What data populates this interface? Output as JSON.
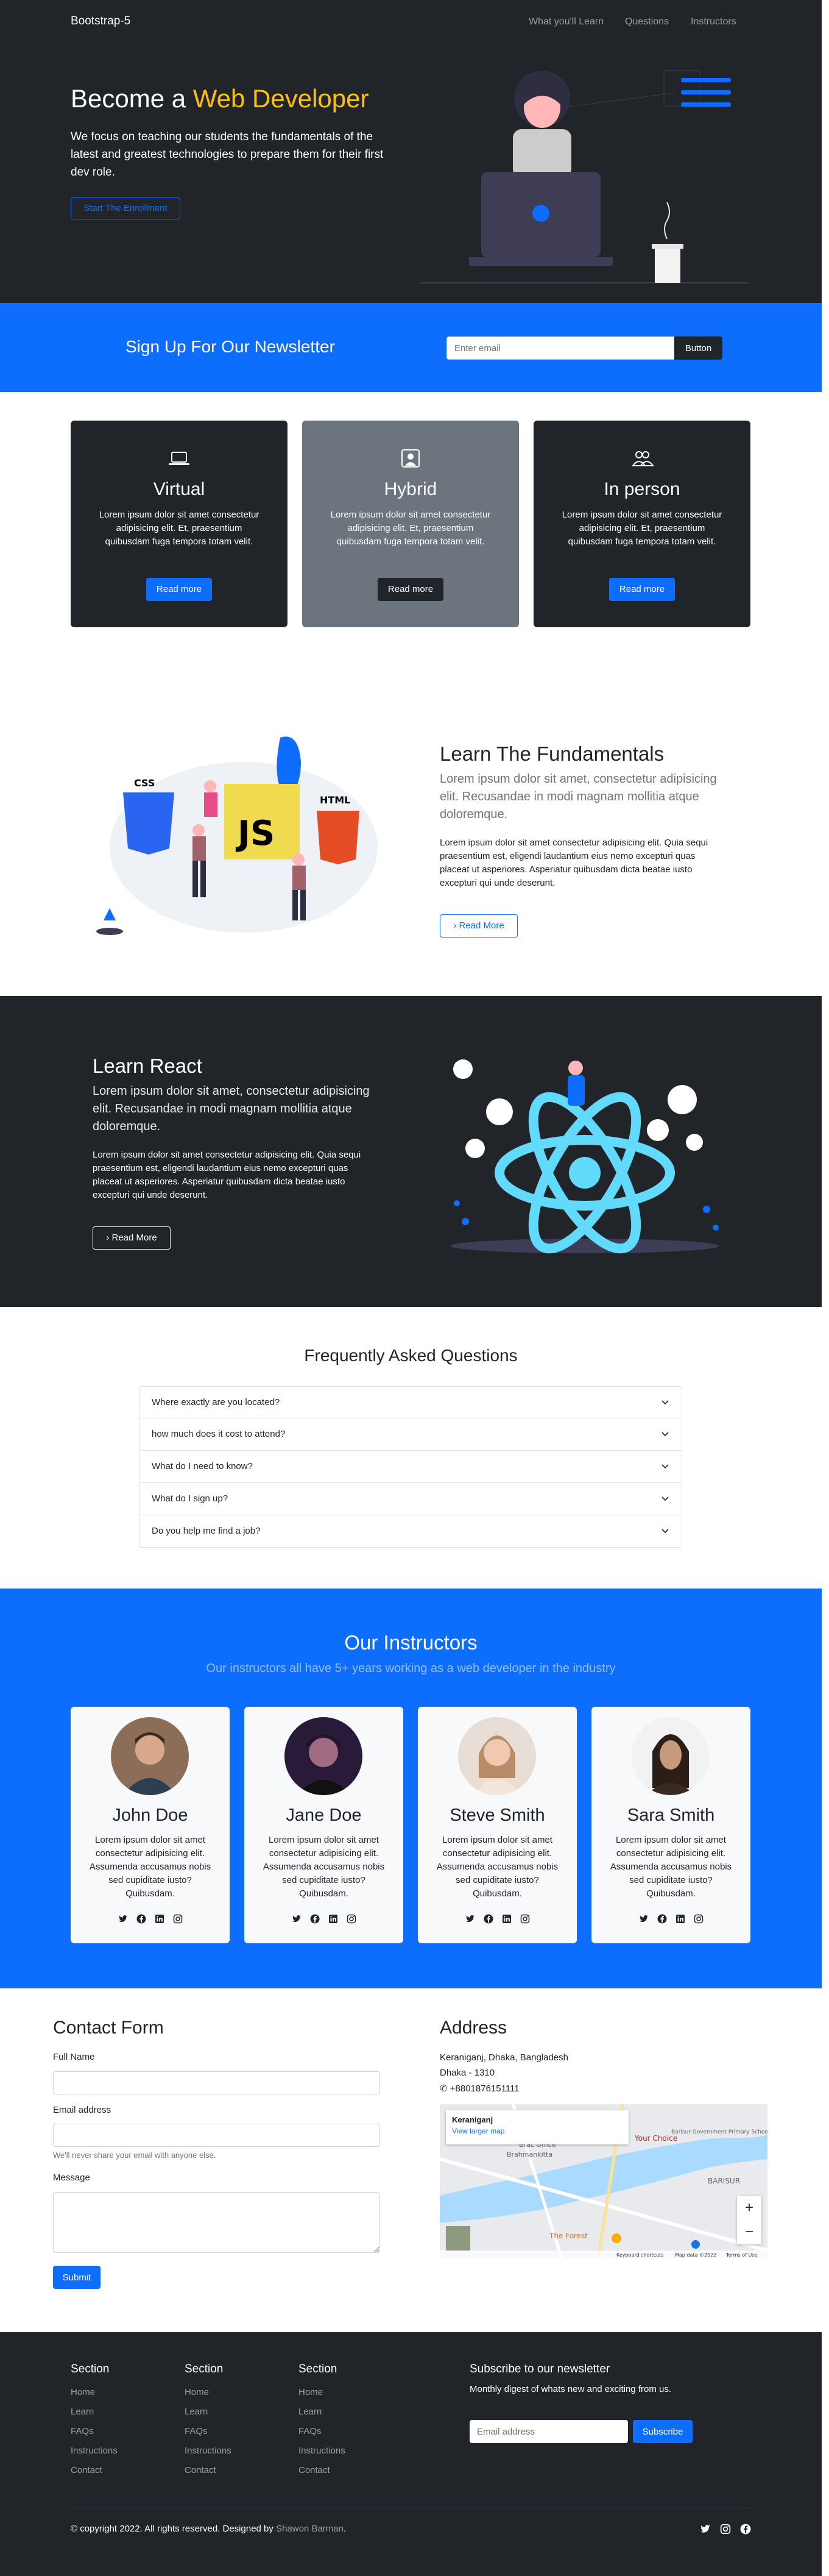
{
  "nav": {
    "brand": "Bootstrap-5",
    "links": [
      "What you'll Learn",
      "Questions",
      "Instructors"
    ]
  },
  "hero": {
    "title_prefix": "Become a ",
    "title_highlight": "Web Developer",
    "text": "We focus on teaching our students the fundamentals of the latest and greatest technologies to prepare them for their first dev role.",
    "button": "Start The Enrollment"
  },
  "newsletter": {
    "title": "Sign Up For Our Newsletter",
    "placeholder": "Enter email",
    "button": "Button"
  },
  "cards": [
    {
      "title": "Virtual",
      "text": "Lorem ipsum dolor sit amet consectetur adipisicing elit. Et, praesentium quibusdam fuga tempora totam velit.",
      "button": "Read more",
      "icon": "laptop-icon",
      "bg": "#212529",
      "btn_bg": "#0d6efd"
    },
    {
      "title": "Hybrid",
      "text": "Lorem ipsum dolor sit amet consectetur adipisicing elit. Et, praesentium quibusdam fuga tempora totam velit.",
      "button": "Read more",
      "icon": "person-badge-icon",
      "bg": "#6c757d",
      "btn_bg": "#212529"
    },
    {
      "title": "In person",
      "text": "Lorem ipsum dolor sit amet consectetur adipisicing elit. Et, praesentium quibusdam fuga tempora totam velit.",
      "button": "Read more",
      "icon": "people-icon",
      "bg": "#212529",
      "btn_bg": "#0d6efd"
    }
  ],
  "fundamentals": {
    "title": "Learn The Fundamentals",
    "lead": "Lorem ipsum dolor sit amet, consectetur adipisicing elit. Recusandae in modi magnam mollitia atque doloremque.",
    "text": "Lorem ipsum dolor sit amet consectetur adipisicing elit. Quia sequi praesentium est, eligendi laudantium eius nemo excepturi quas placeat ut asperiores. Asperiatur quibusdam dicta beatae iusto excepturi qui unde deserunt.",
    "button": "Read More",
    "illustration_labels": [
      "CSS",
      "JS",
      "HTML"
    ]
  },
  "react": {
    "title": "Learn React",
    "lead": "Lorem ipsum dolor sit amet, consectetur adipisicing elit. Recusandae in modi magnam mollitia atque doloremque.",
    "text": "Lorem ipsum dolor sit amet consectetur adipisicing elit. Quia sequi praesentium est, eligendi laudantium eius nemo excepturi quas placeat ut asperiores. Asperiatur quibusdam dicta beatae iusto excepturi qui unde deserunt.",
    "button": "Read More"
  },
  "faq": {
    "title": "Frequently Asked Questions",
    "items": [
      "Where exactly are you located?",
      "how much does it cost to attend?",
      "What do I need to know?",
      "What do I sign up?",
      "Do you help me find a job?"
    ]
  },
  "instructors": {
    "title": "Our Instructors",
    "subtitle": "Our instructors all have 5+ years working as a web developer in the industry",
    "people": [
      {
        "name": "John Doe",
        "text": "Lorem ipsum dolor sit amet consectetur adipisicing elit. Assumenda accusamus nobis sed cupiditate iusto? Quibusdam."
      },
      {
        "name": "Jane Doe",
        "text": "Lorem ipsum dolor sit amet consectetur adipisicing elit. Assumenda accusamus nobis sed cupiditate iusto? Quibusdam."
      },
      {
        "name": "Steve Smith",
        "text": "Lorem ipsum dolor sit amet consectetur adipisicing elit. Assumenda accusamus nobis sed cupiditate iusto? Quibusdam."
      },
      {
        "name": "Sara Smith",
        "text": "Lorem ipsum dolor sit amet consectetur adipisicing elit. Assumenda accusamus nobis sed cupiditate iusto? Quibusdam."
      }
    ],
    "social_icons": [
      "twitter-icon",
      "facebook-icon",
      "linkedin-icon",
      "instagram-icon"
    ]
  },
  "contact": {
    "title": "Contact Form",
    "name_label": "Full Name",
    "email_label": "Email address",
    "email_help": "We'll never share your email with anyone else.",
    "message_label": "Message",
    "submit": "Submit"
  },
  "address": {
    "title": "Address",
    "line1": "Keraniganj, Dhaka, Bangladesh",
    "line2": "Dhaka - 1310",
    "phone": "+8801876151111",
    "map_place": "Keraniganj",
    "map_link": "View larger map",
    "map_labels": [
      "Your Choice",
      "Brac Office",
      "Brahmankitta",
      "BARISUR",
      "The Forest",
      "Barisur Government Primary School"
    ],
    "map_footer": [
      "Keyboard shortcuts",
      "Map data ©2022",
      "Terms of Use"
    ]
  },
  "footer": {
    "columns": [
      {
        "title": "Section",
        "links": [
          "Home",
          "Learn",
          "FAQs",
          "Instructions",
          "Contact"
        ]
      },
      {
        "title": "Section",
        "links": [
          "Home",
          "Learn",
          "FAQs",
          "Instructions",
          "Contact"
        ]
      },
      {
        "title": "Section",
        "links": [
          "Home",
          "Learn",
          "FAQs",
          "Instructions",
          "Contact"
        ]
      }
    ],
    "subscribe_title": "Subscribe to our newsletter",
    "subscribe_text": "Monthly digest of whats new and exciting from us.",
    "subscribe_placeholder": "Email address",
    "subscribe_button": "Subscribe",
    "copyright": "© copyright 2022. All rights reserved. Designed by ",
    "author": "Shawon Barman",
    "period": "."
  },
  "colors": {
    "primary": "#0d6efd",
    "dark": "#212529",
    "secondary": "#6c757d",
    "warning": "#ffc107"
  }
}
